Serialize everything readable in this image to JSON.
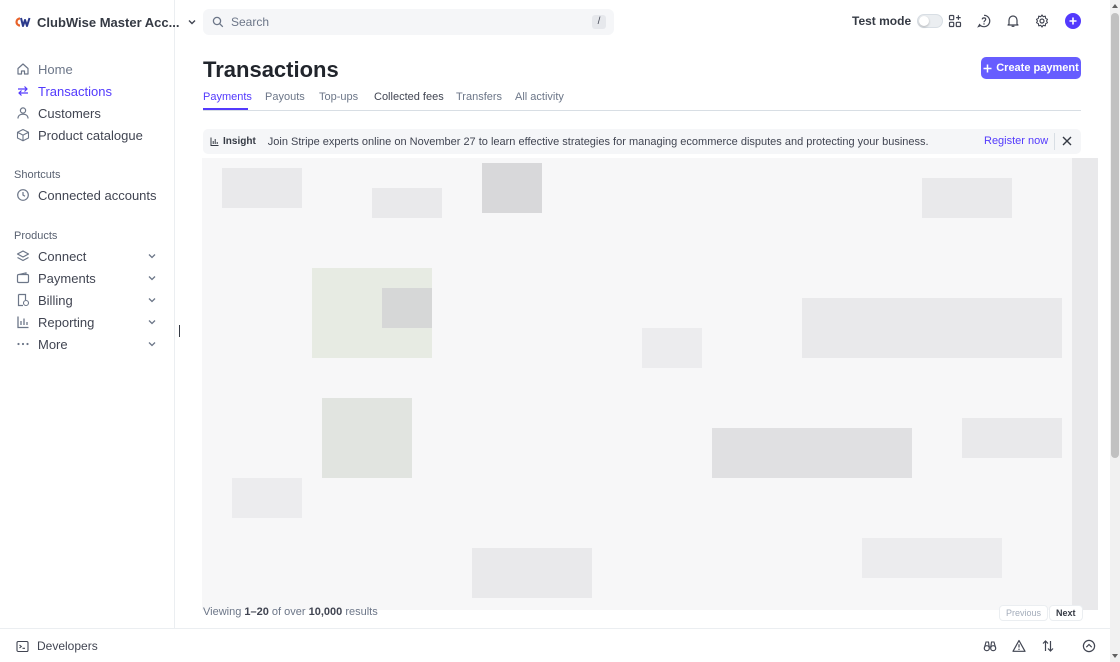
{
  "account": {
    "name": "ClubWise Master Acc...",
    "logo": "CW"
  },
  "search": {
    "placeholder": "Search",
    "shortcut": "/"
  },
  "topbar": {
    "test_mode_label": "Test mode",
    "test_mode_on": false
  },
  "nav": {
    "main": [
      {
        "label": "Home",
        "icon": "home-icon"
      },
      {
        "label": "Transactions",
        "icon": "arrows-swap-icon",
        "active": true
      },
      {
        "label": "Customers",
        "icon": "person-icon"
      },
      {
        "label": "Product catalogue",
        "icon": "box-icon"
      }
    ],
    "shortcuts_label": "Shortcuts",
    "shortcuts": [
      {
        "label": "Connected accounts",
        "icon": "clock-icon"
      }
    ],
    "products_label": "Products",
    "products": [
      {
        "label": "Connect",
        "icon": "layers-icon"
      },
      {
        "label": "Payments",
        "icon": "wallet-icon"
      },
      {
        "label": "Billing",
        "icon": "invoice-icon"
      },
      {
        "label": "Reporting",
        "icon": "bar-chart-icon"
      },
      {
        "label": "More",
        "icon": "dots-icon"
      }
    ]
  },
  "page": {
    "title": "Transactions",
    "create_button": "Create payment",
    "tabs": [
      "Payments",
      "Payouts",
      "Top-ups",
      "Collected fees",
      "Transfers",
      "All activity"
    ],
    "active_tab": "Payments"
  },
  "insight": {
    "label": "Insight",
    "text": "Join Stripe experts online on November 27 to learn effective strategies for managing ecommerce disputes and protecting your business.",
    "link": "Register now"
  },
  "pagination": {
    "prefix": "Viewing ",
    "range": "1–20",
    "middle": " of over ",
    "total": "10,000",
    "suffix": " results",
    "previous": "Previous",
    "next": "Next"
  },
  "bottombar": {
    "developers": "Developers"
  },
  "colors": {
    "accent": "#533afd",
    "button": "#675dff",
    "sidebar_text": "#414552"
  }
}
